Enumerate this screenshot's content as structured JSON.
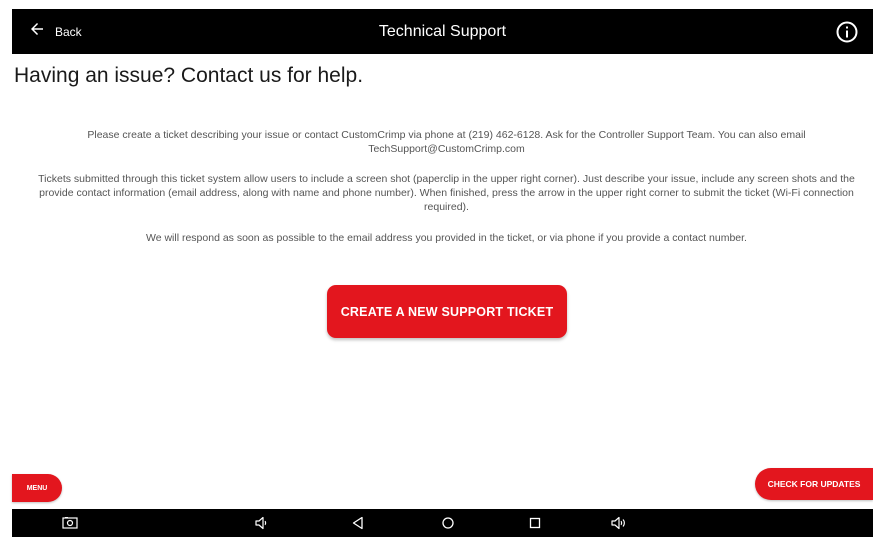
{
  "topbar": {
    "back_label": "Back",
    "title": "Technical Support",
    "back_icon": "arrow-left-icon",
    "info_icon": "info-icon"
  },
  "main": {
    "heading": "Having an issue? Contact us for help.",
    "paragraphs": [
      "Please create a ticket describing your issue or contact CustomCrimp via phone at (219) 462-6128. Ask for the Controller Support Team. You can also email TechSupport@CustomCrimp.com",
      "Tickets submitted through this ticket system allow users to include a screen shot (paperclip in the upper right corner). Just describe your issue, include any screen shots and the provide contact information (email address, along with name and phone number). When finished, press the arrow in the upper right corner to submit the ticket (Wi-Fi connection required).",
      "We will respond as soon as possible to the email address you provided in the ticket, or via phone if you provide a contact number."
    ],
    "create_ticket_label": "CREATE A NEW SUPPORT TICKET"
  },
  "footer": {
    "menu_label": "MENU",
    "updates_label": "CHECK FOR UPDATES"
  },
  "navbar": {
    "icons": [
      "screenshot-icon",
      "volume-down-icon",
      "nav-back-icon",
      "nav-home-icon",
      "nav-recents-icon",
      "volume-up-icon"
    ]
  },
  "colors": {
    "accent": "#e3161e",
    "bar": "#000000",
    "text": "#555555"
  }
}
